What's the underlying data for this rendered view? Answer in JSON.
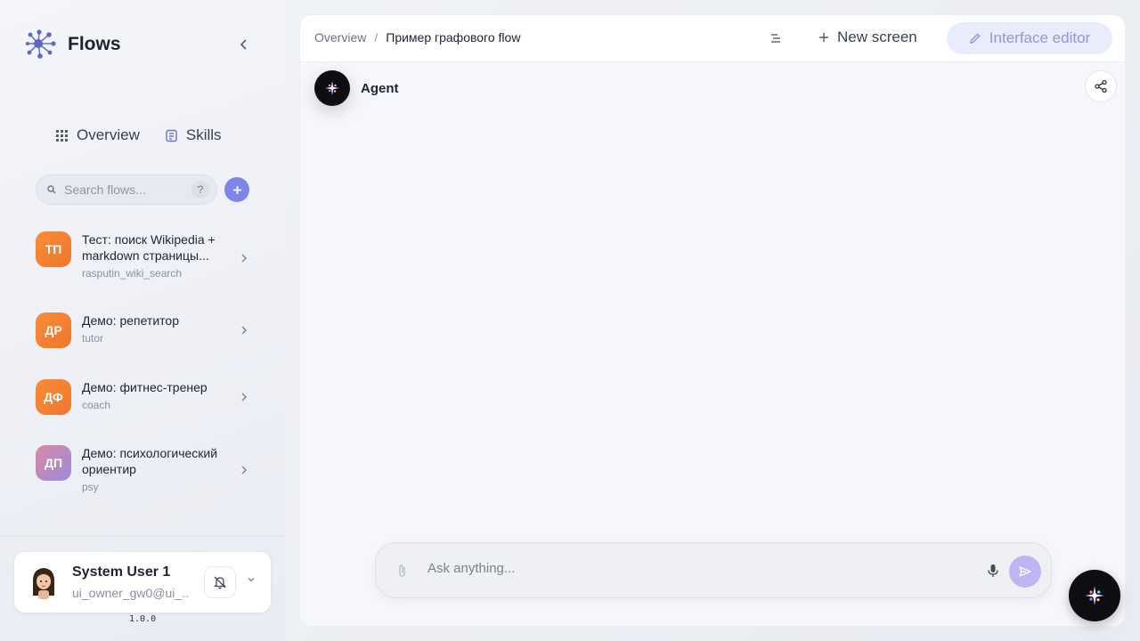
{
  "app": {
    "name": "Flows",
    "version": "1.0.0"
  },
  "nav": {
    "overview_label": "Overview",
    "skills_label": "Skills"
  },
  "search": {
    "placeholder": "Search flows...",
    "help_label": "?"
  },
  "flows": [
    {
      "initials": "ТП",
      "title": "Тест: поиск Wikipedia + markdown страницы...",
      "slug": "rasputin_wiki_search",
      "color": "#f47f30"
    },
    {
      "initials": "ДР",
      "title": "Демо: репетитор",
      "slug": "tutor",
      "color": "#f47f30"
    },
    {
      "initials": "ДФ",
      "title": "Демо: фитнес-тренер",
      "slug": "coach",
      "color": "#f47f30"
    },
    {
      "initials": "ДП",
      "title": "Демо: психологический ориентир",
      "slug": "psy",
      "color": "#b28ac0"
    }
  ],
  "user": {
    "name": "System User 1",
    "email": "ui_owner_gw0@ui_..."
  },
  "breadcrumb": {
    "root": "Overview",
    "separator": "/",
    "current": "Пример графового flow"
  },
  "toolbar": {
    "new_screen_label": "New screen",
    "interface_editor_label": "Interface editor"
  },
  "agent": {
    "name": "Agent"
  },
  "composer": {
    "placeholder": "Ask anything..."
  },
  "colors": {
    "accent": "#7e85e8",
    "flow_orange": "#f47f30",
    "send_button": "#bfb5f2"
  },
  "icons": [
    "flows-logo-icon",
    "chevron-left-icon",
    "grid-icon",
    "scroll-icon",
    "search-icon",
    "plus-icon",
    "chevron-right-icon",
    "bell-off-icon",
    "chevron-down-icon",
    "list-icon",
    "pencil-icon",
    "sparkle-icon",
    "share-icon",
    "paperclip-icon",
    "mic-icon",
    "send-icon"
  ]
}
